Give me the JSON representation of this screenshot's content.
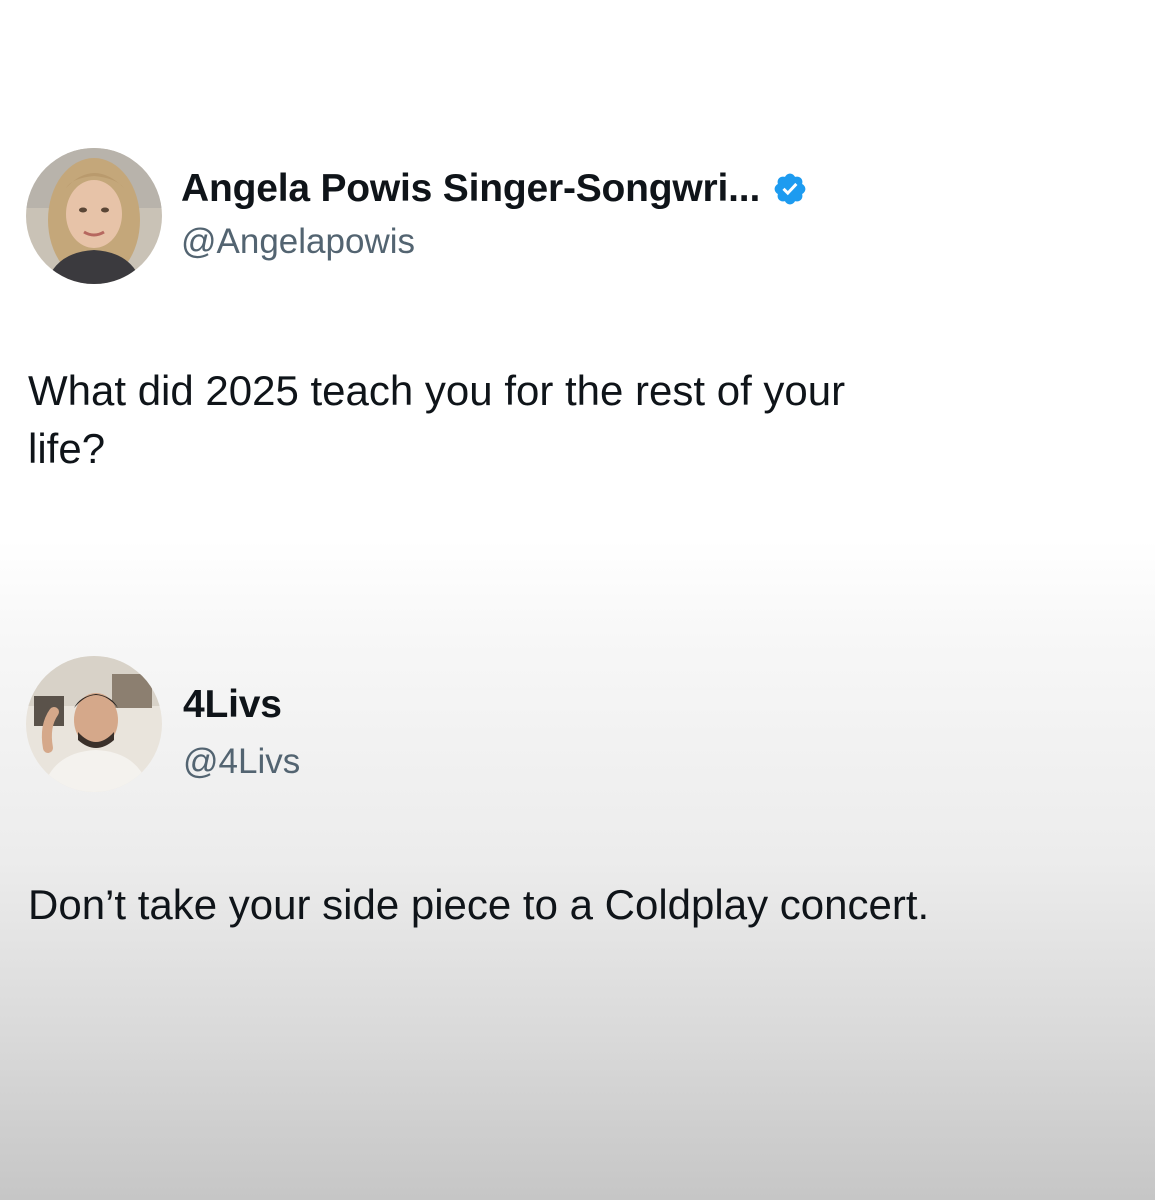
{
  "posts": [
    {
      "display_name": "Angela Powis Singer-Songwri...",
      "handle": "@Angelapowis",
      "verified": true,
      "avatar_icon": "user-photo-woman",
      "text": "What did 2025 teach you for the rest of your\nlife?"
    },
    {
      "display_name": "4Livs",
      "handle": "@4Livs",
      "verified": false,
      "avatar_icon": "user-photo-man",
      "text": "Don’t take your side piece to a Coldplay concert."
    }
  ],
  "colors": {
    "verified_badge": "#1d9bf0",
    "handle_text": "#536471",
    "body_text": "#0f1419"
  }
}
